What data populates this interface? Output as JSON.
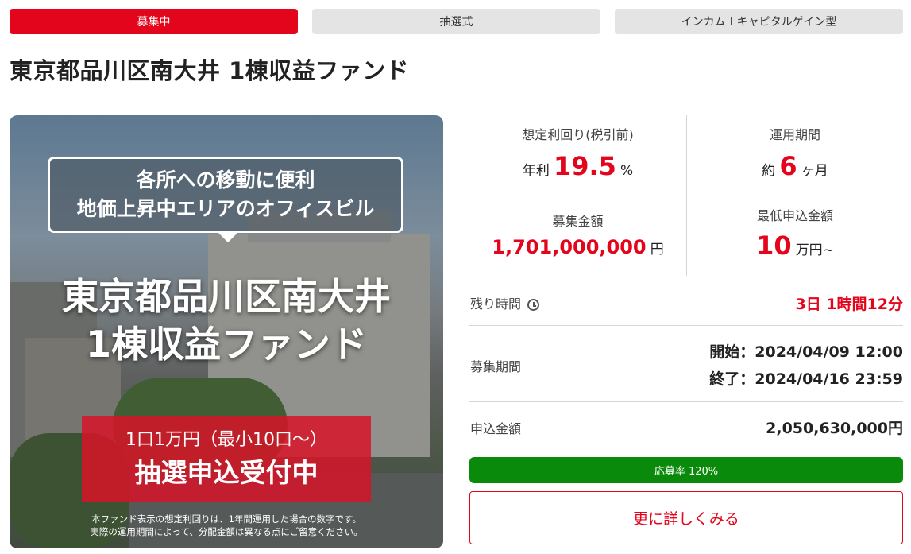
{
  "tags": {
    "status": "募集中",
    "method": "抽選式",
    "type": "インカム＋キャピタルゲイン型"
  },
  "title": "東京都品川区南大井 1棟収益ファンド",
  "hero": {
    "bubble_line1": "各所への移動に便利",
    "bubble_line2": "地価上昇中エリアのオフィスビル",
    "name_line1": "東京都品川区南大井",
    "name_line2": "1棟収益ファンド",
    "unit_line": "1口1万円（最小10口〜）",
    "lottery_line": "抽選申込受付中",
    "note_line1": "本ファンド表示の想定利回りは、1年間運用した場合の数字です。",
    "note_line2": "実際の運用期間によって、分配金額は異なる点にご留意ください。"
  },
  "stats": {
    "yield_label": "想定利回り(税引前)",
    "yield_prefix": "年利",
    "yield_value": "19.5",
    "yield_unit": "%",
    "period_label": "運用期間",
    "period_prefix": "約",
    "period_value": "6",
    "period_unit": "ヶ月",
    "amount_label": "募集金額",
    "amount_value": "1,701,000,000",
    "amount_unit": "円",
    "min_label": "最低申込金額",
    "min_value": "10",
    "min_unit": "万円~"
  },
  "remaining": {
    "label": "残り時間",
    "value": "3日 1時間12分"
  },
  "recruit_period": {
    "label": "募集期間",
    "start": "開始：2024/04/09 12:00",
    "end": "終了：2024/04/16 23:59"
  },
  "applied": {
    "label": "申込金額",
    "value": "2,050,630,000円"
  },
  "progress": {
    "text": "応募率 120%",
    "percent": 120
  },
  "more_button": "更に詳しくみる",
  "colors": {
    "accent": "#e3051b",
    "progress": "#0a8a0a"
  }
}
